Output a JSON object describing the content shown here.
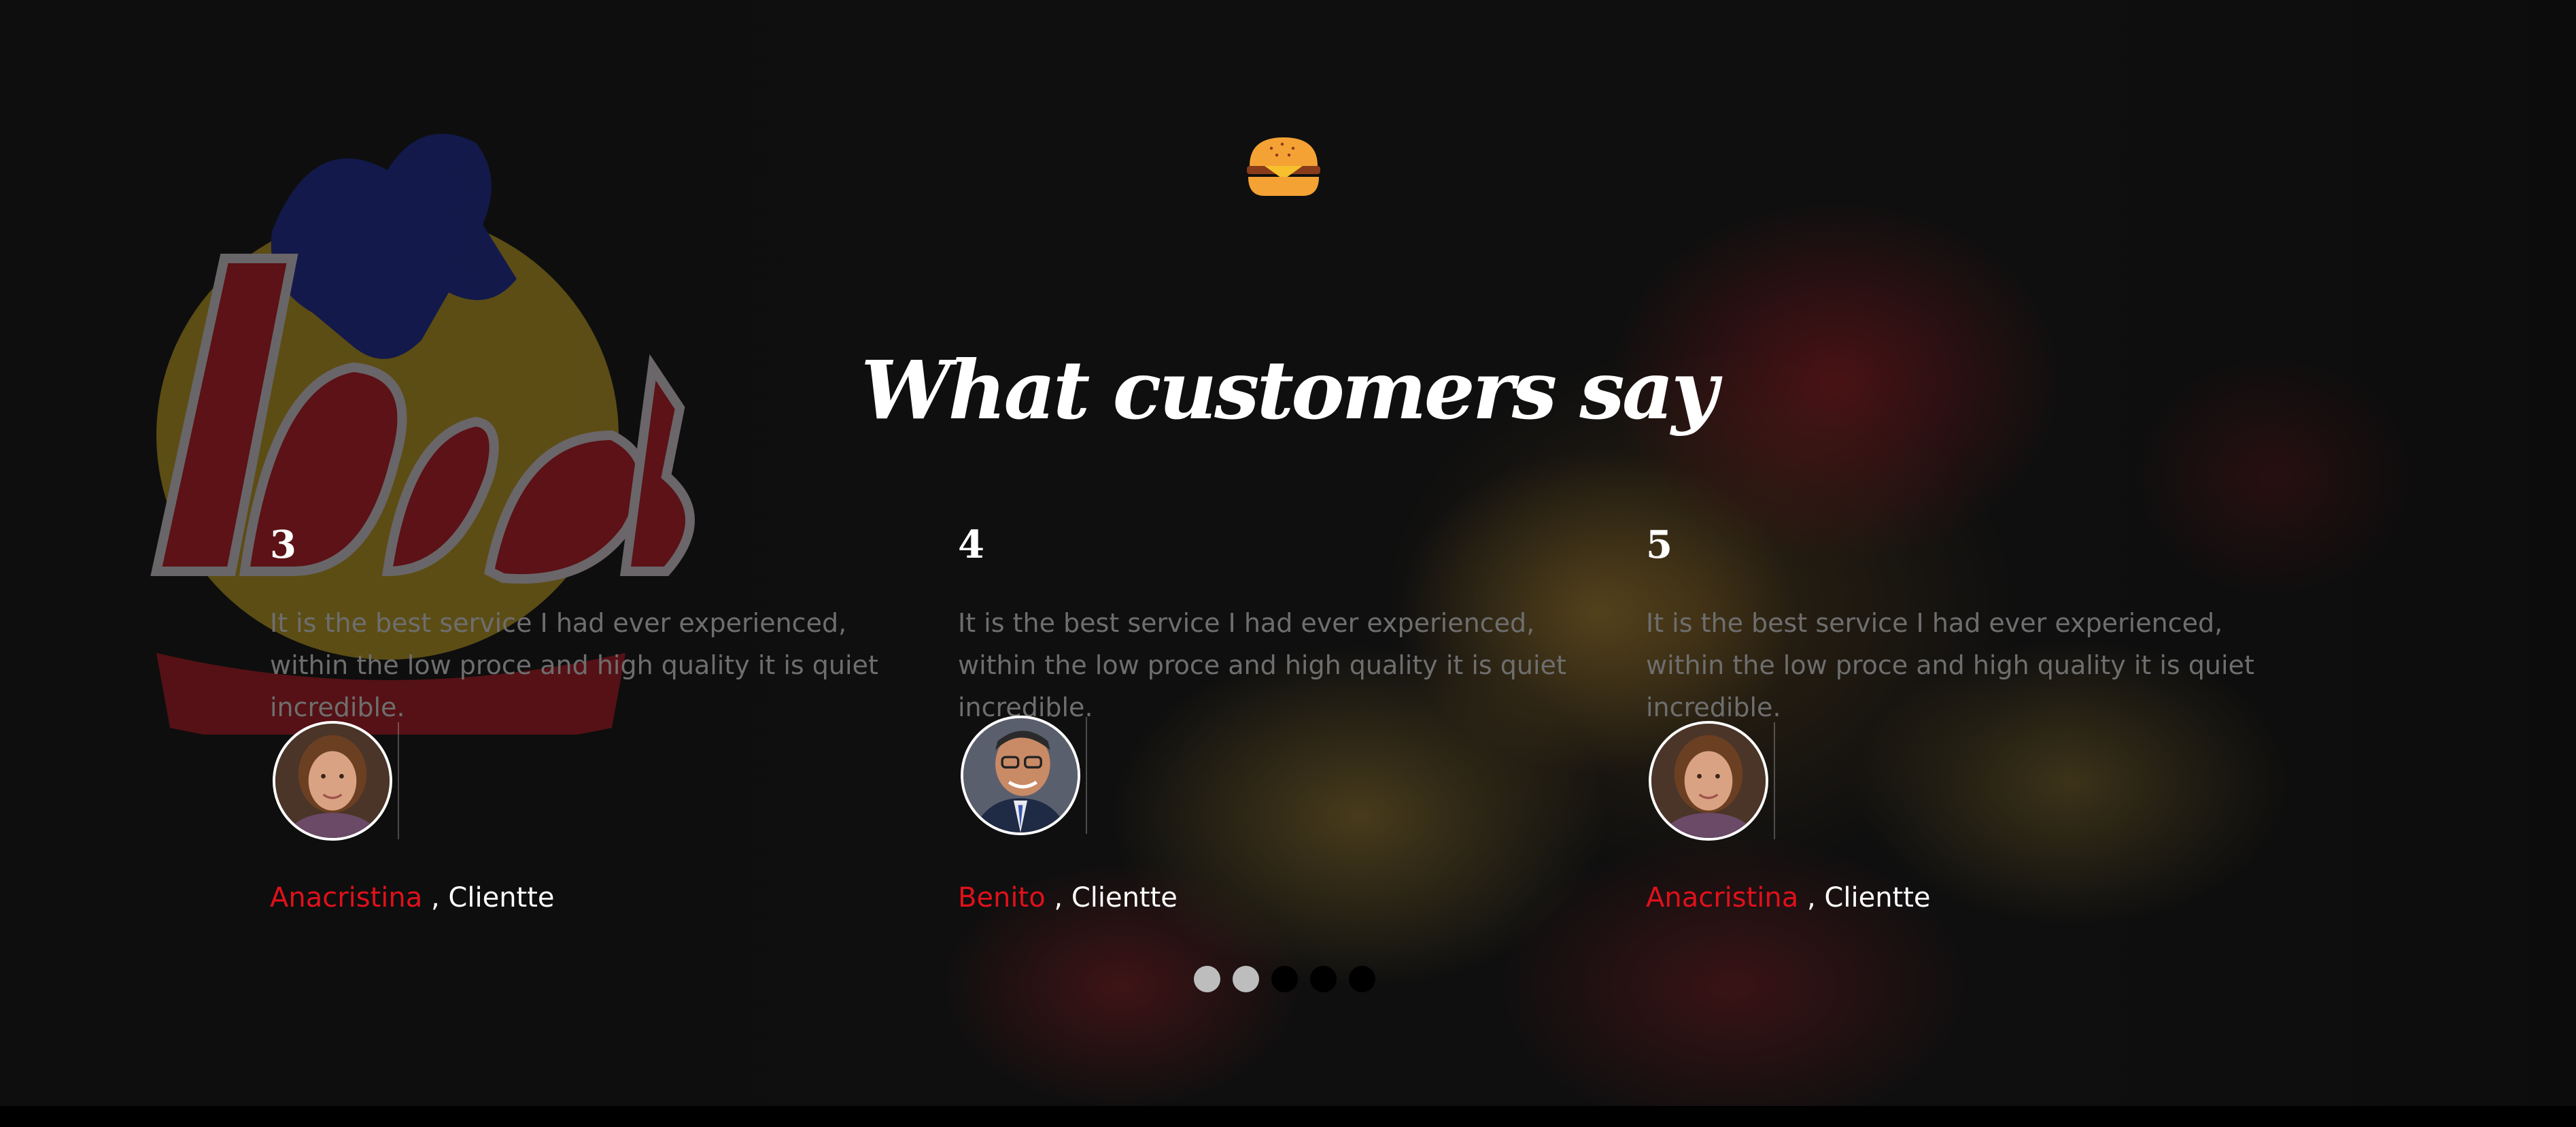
{
  "header": {
    "title": "What customers say"
  },
  "colors": {
    "accent_red": "#e0111a",
    "burger_orange": "#f4a234",
    "burger_patty": "#8a3b1a"
  },
  "icons": {
    "header_icon": "burger-icon",
    "background_logo": "ibras-logo"
  },
  "testimonials": [
    {
      "number": "3",
      "text": "It is the best service I had ever experienced, within the low proce and high quality it is quiet incredible.",
      "name": "Anacristina",
      "role": " , Clientte",
      "avatar": "woman-avatar"
    },
    {
      "number": "4",
      "text": "It is the best service I had ever experienced, within the low proce and high quality it is quiet incredible.",
      "name": "Benito",
      "role": " , Clientte",
      "avatar": "man-avatar"
    },
    {
      "number": "5",
      "text": "It is the best service I had ever experienced, within the low proce and high quality it is quiet incredible.",
      "name": "Anacristina",
      "role": " , Clientte",
      "avatar": "woman-avatar"
    }
  ],
  "pagination": {
    "total": 5,
    "active": [
      1,
      2
    ]
  }
}
